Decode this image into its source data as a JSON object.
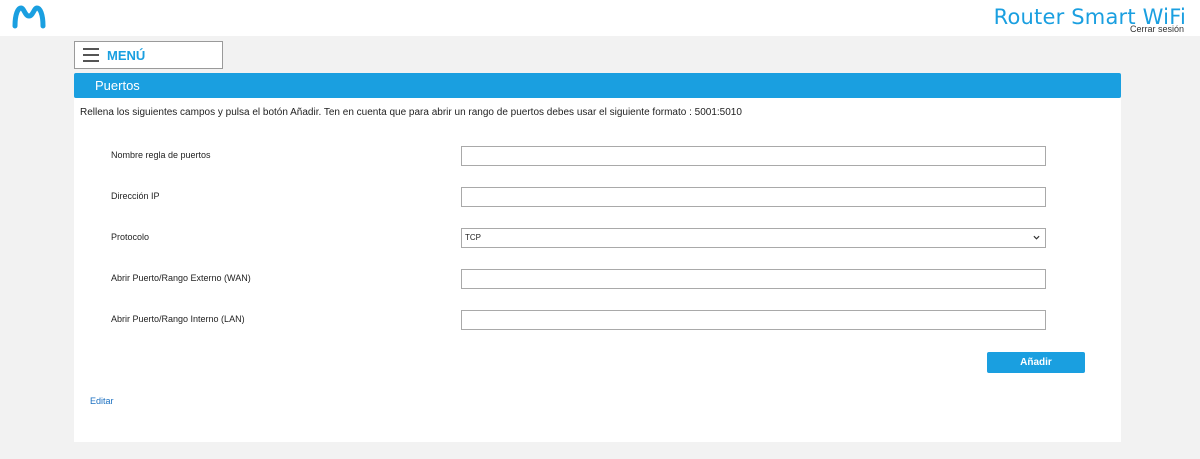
{
  "header": {
    "logo_icon": "movistar-logo-icon",
    "app_title": "Router Smart WiFi",
    "logout_label": "Cerrar sesión",
    "brand_color": "#1a9fe0"
  },
  "menu": {
    "label": "MENÚ",
    "icon": "hamburger-icon"
  },
  "section": {
    "title": "Puertos"
  },
  "instructions": "Rellena los siguientes campos y pulsa el botón Añadir. Ten en cuenta que para abrir un rango de puertos debes usar el siguiente formato : 5001:5010",
  "form": {
    "fields": [
      {
        "label": "Nombre regla de puertos",
        "value": "",
        "placeholder": ""
      },
      {
        "label": "Dirección IP",
        "value": "",
        "placeholder": ""
      },
      {
        "label": "Protocolo",
        "value": "TCP",
        "icon": "chevron-down-icon"
      },
      {
        "label": "Abrir Puerto/Rango Externo (WAN)",
        "value": "",
        "placeholder": ""
      },
      {
        "label": "Abrir Puerto/Rango Interno (LAN)",
        "value": "",
        "placeholder": ""
      }
    ],
    "submit_label": "Añadir"
  },
  "edit_link": "Editar"
}
